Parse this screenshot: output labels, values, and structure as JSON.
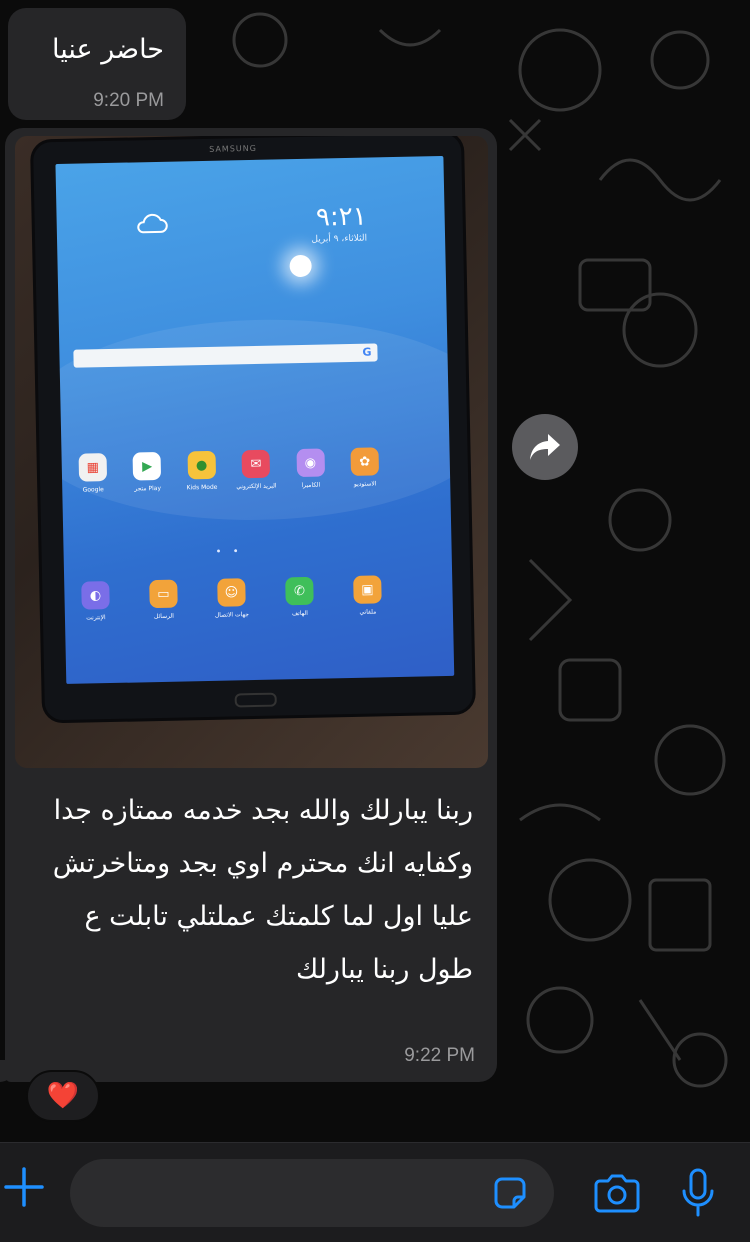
{
  "colors": {
    "background": "#0b0b0b",
    "bubble": "#262628",
    "accent_blue": "#1e8fff",
    "reaction_red": "#ff2d3a"
  },
  "messages": [
    {
      "text": "حاضر عنيا",
      "time": "9:20 PM"
    },
    {
      "image": {
        "tablet_brand": "SAMSUNG",
        "tablet_clock": "٩:٢١",
        "tablet_date": "الثلاثاء، ٩ أبريل",
        "apps_row_1": [
          "Google",
          "متجر Play",
          "Kids Mode",
          "البريد الإلكتروني",
          "الكاميرا",
          "الاستوديو"
        ],
        "apps_row_2": [
          "الإنترنت",
          "الرسائل",
          "جهات الاتصال",
          "الهاتف",
          "ملفاتي"
        ]
      },
      "text": "ربنا يبارلك والله بجد خدمه ممتازه جدا وكفايه انك محترم اوي بجد ومتاخرتش عليا اول لما كلمتك عملتلي تابلت ع طول ربنا يبارلك",
      "time": "9:22 PM",
      "reaction": "❤️"
    }
  ],
  "icons": {
    "forward": "forward-icon",
    "plus": "plus-icon",
    "sticker": "sticker-icon",
    "camera": "camera-icon",
    "mic": "microphone-icon"
  }
}
